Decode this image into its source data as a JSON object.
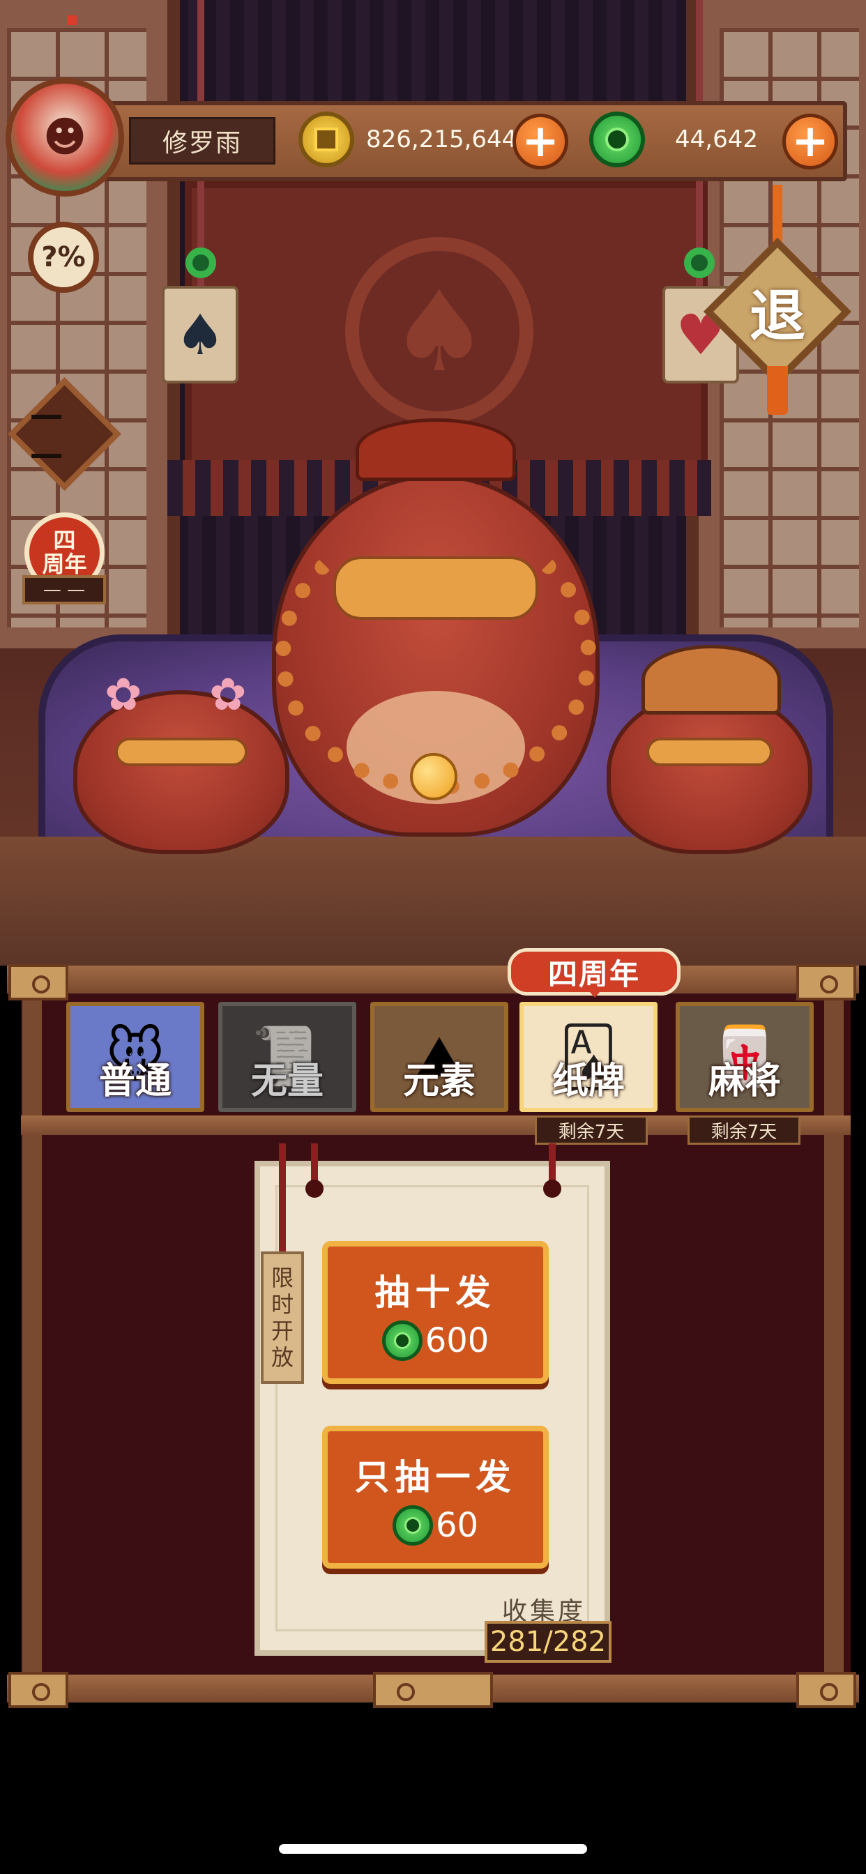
{
  "player": {
    "name": "修罗雨"
  },
  "currency": {
    "gold": "826,215,644",
    "jade": "44,642"
  },
  "side": {
    "probability": "?%",
    "menu_face": "— —",
    "anniversary_badge_line1": "四",
    "anniversary_badge_line2": "周年",
    "anniversary_label": "— —",
    "exit": "退"
  },
  "tabs": [
    {
      "label": "普通",
      "icon": "mouse-icon"
    },
    {
      "label": "无量",
      "icon": "talisman-icon"
    },
    {
      "label": "元素",
      "icon": "mountain-icon"
    },
    {
      "label": "纸牌",
      "icon": "playing-cards-icon"
    },
    {
      "label": "麻将",
      "icon": "mahjong-icon"
    }
  ],
  "anniversary_flag": "四周年",
  "remaining": [
    "剩余7天",
    "剩余7天"
  ],
  "limited_tag": [
    "限",
    "时",
    "开",
    "放"
  ],
  "draw_ten": {
    "label": "抽十发",
    "cost": "600"
  },
  "draw_one": {
    "label": "只抽一发",
    "cost": "60"
  },
  "collection": {
    "label": "收集度",
    "value": "281/282"
  },
  "colors": {
    "accent": "#d0561d",
    "jade": "#1f9a36",
    "gold": "#c99318"
  }
}
